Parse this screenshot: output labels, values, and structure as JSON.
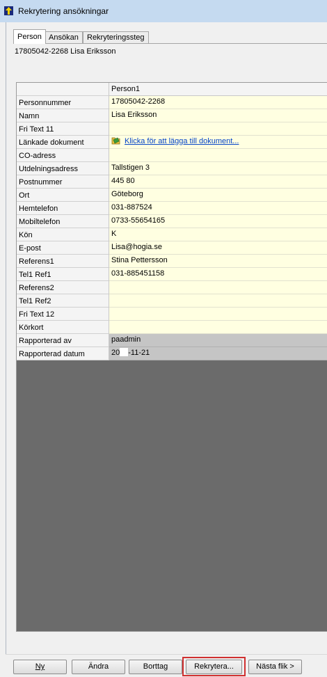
{
  "window": {
    "title": "Rekrytering ansökningar"
  },
  "tabs": [
    {
      "label": "Person",
      "active": true
    },
    {
      "label": "Ansökan",
      "active": false
    },
    {
      "label": "Rekryteringssteg",
      "active": false
    }
  ],
  "person_line": "17805042-2268 Lisa Eriksson",
  "grid": {
    "column_header": "Person1",
    "rows": [
      {
        "label": "Personnummer",
        "value": "17805042-2268"
      },
      {
        "label": "Namn",
        "value": "Lisa Eriksson"
      },
      {
        "label": "Fri Text 11",
        "value": ""
      },
      {
        "label": "Länkade dokument",
        "value": "Klicka för att lägga till dokument...",
        "link": true
      },
      {
        "label": "CO-adress",
        "value": ""
      },
      {
        "label": "Utdelningsadress",
        "value": "Tallstigen 3"
      },
      {
        "label": "Postnummer",
        "value": "445 80"
      },
      {
        "label": "Ort",
        "value": "Göteborg"
      },
      {
        "label": "Hemtelefon",
        "value": "031-887524"
      },
      {
        "label": "Mobiltelefon",
        "value": "0733-55654165"
      },
      {
        "label": "Kön",
        "value": "K"
      },
      {
        "label": "E-post",
        "value": "Lisa@hogia.se"
      },
      {
        "label": "Referens1",
        "value": "Stina Pettersson"
      },
      {
        "label": "Tel1 Ref1",
        "value": "031-885451158"
      },
      {
        "label": "Referens2",
        "value": ""
      },
      {
        "label": "Tel1 Ref2",
        "value": ""
      },
      {
        "label": "Fri Text 12",
        "value": ""
      },
      {
        "label": "Körkort",
        "value": ""
      },
      {
        "label": "Rapporterad av",
        "value": "paadmin",
        "readonly": true
      },
      {
        "label": "Rapporterad datum",
        "value_prefix": "20",
        "value_suffix": "-11-21",
        "readonly": true
      }
    ]
  },
  "buttons": {
    "new": "Ny",
    "edit": "Ändra",
    "delete": "Borttag",
    "recruit": "Rekrytera...",
    "next_tab": "Nästa flik >"
  },
  "colors": {
    "value_bg": "#ffffe1",
    "readonly_bg": "#c5c5c5",
    "grid_empty_bg": "#6b6b6b",
    "highlight": "#d03030"
  }
}
